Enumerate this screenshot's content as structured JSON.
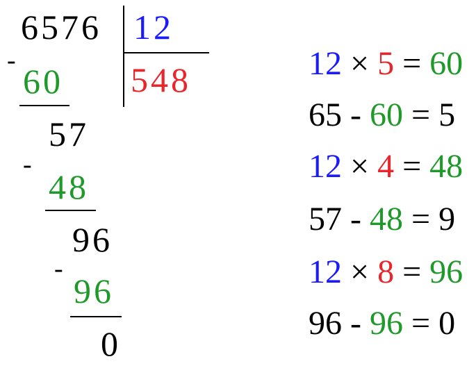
{
  "division": {
    "dividend": "6576",
    "divisor": "12",
    "quotient": "548",
    "steps": [
      {
        "subtract": "60",
        "remainder_line": "57"
      },
      {
        "subtract": "48",
        "remainder_line": "96"
      },
      {
        "subtract": "96",
        "remainder_line": "0"
      }
    ],
    "minus_sign": "-"
  },
  "equations": [
    {
      "a": "12",
      "op": "×",
      "b": "5",
      "eq": "=",
      "c": "60"
    },
    {
      "a": "65",
      "op": "-",
      "b": "60",
      "eq": "=",
      "c": "5"
    },
    {
      "a": "12",
      "op": "×",
      "b": "4",
      "eq": "=",
      "c": "48"
    },
    {
      "a": "57",
      "op": "-",
      "b": "48",
      "eq": "=",
      "c": "9"
    },
    {
      "a": "12",
      "op": "×",
      "b": "8",
      "eq": "=",
      "c": "96"
    },
    {
      "a": "96",
      "op": "-",
      "b": "96",
      "eq": "=",
      "c": "0"
    }
  ],
  "colors": {
    "divisor": "#1a1aff",
    "quotient": "#e8262b",
    "product": "#1f9a2a",
    "text": "#000000"
  }
}
